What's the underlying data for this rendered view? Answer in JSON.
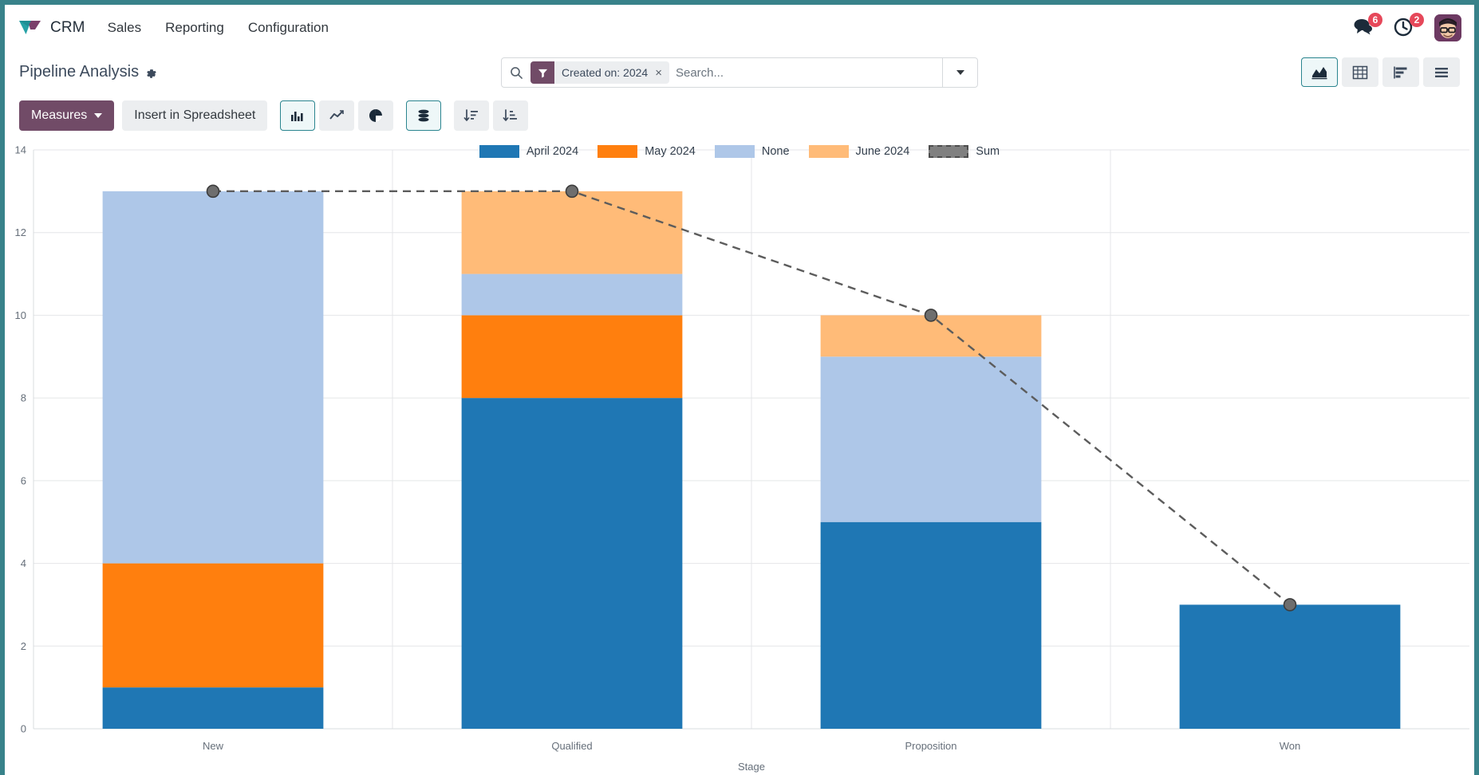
{
  "navbar": {
    "brand": "CRM",
    "menus": [
      {
        "label": "Sales"
      },
      {
        "label": "Reporting"
      },
      {
        "label": "Configuration"
      }
    ],
    "messages_badge": "6",
    "activities_badge": "2",
    "messages_icon": "chat-bubbles-icon",
    "activities_icon": "clock-icon",
    "avatar_icon": "user-avatar"
  },
  "control_panel": {
    "title": "Pipeline Analysis",
    "settings_icon": "gear-icon",
    "search": {
      "placeholder": "Search...",
      "value": "",
      "search_icon": "search-icon",
      "dropdown_icon": "chevron-down-icon",
      "facets": [
        {
          "label": "Created on: 2024",
          "icon": "filter-icon",
          "remove": "×"
        }
      ]
    },
    "view_switcher": [
      {
        "name": "graph",
        "icon": "area-chart-icon",
        "active": true
      },
      {
        "name": "pivot",
        "icon": "table-grid-icon",
        "active": false
      },
      {
        "name": "cohort",
        "icon": "horizontal-bars-icon",
        "active": false
      },
      {
        "name": "list",
        "icon": "list-lines-icon",
        "active": false
      }
    ]
  },
  "toolbar": {
    "measures_label": "Measures",
    "spreadsheet_label": "Insert in Spreadsheet",
    "chart_types": [
      {
        "name": "bar",
        "icon": "bar-chart-icon",
        "active": true
      },
      {
        "name": "line",
        "icon": "line-chart-icon",
        "active": false
      },
      {
        "name": "pie",
        "icon": "pie-chart-icon",
        "active": false
      }
    ],
    "options": [
      {
        "name": "stacked",
        "icon": "stacked-database-icon",
        "active": true
      }
    ],
    "sorting": [
      {
        "name": "sort-descending",
        "icon": "sort-amount-desc-icon",
        "active": false
      },
      {
        "name": "sort-ascending",
        "icon": "sort-amount-asc-icon",
        "active": false
      }
    ]
  },
  "chart_data": {
    "type": "bar",
    "stacked": true,
    "title": "",
    "xlabel": "Stage",
    "ylabel": "",
    "categories": [
      "New",
      "Qualified",
      "Proposition",
      "Won"
    ],
    "ylim": [
      0,
      14
    ],
    "yticks": [
      0,
      2,
      4,
      6,
      8,
      10,
      12,
      14
    ],
    "grid": true,
    "legend_position": "top",
    "series": [
      {
        "name": "April 2024",
        "color": "#1F77B4",
        "values": [
          1,
          8,
          5,
          3
        ]
      },
      {
        "name": "May 2024",
        "color": "#FF7F0E",
        "values": [
          3,
          2,
          0,
          0
        ]
      },
      {
        "name": "None",
        "color": "#AEC7E8",
        "values": [
          9,
          1,
          4,
          0
        ]
      },
      {
        "name": "June 2024",
        "color": "#FFBB78",
        "values": [
          0,
          2,
          1,
          0
        ]
      }
    ],
    "sum_line": {
      "name": "Sum",
      "color": "#808080",
      "style": "dashed",
      "values": [
        13,
        13,
        10,
        3
      ]
    },
    "stack_totals": [
      13,
      13,
      10,
      3
    ]
  },
  "colors": {
    "brand_teal": "#38828a",
    "accent_purple": "#714b67",
    "badge_red": "#e6485a"
  }
}
